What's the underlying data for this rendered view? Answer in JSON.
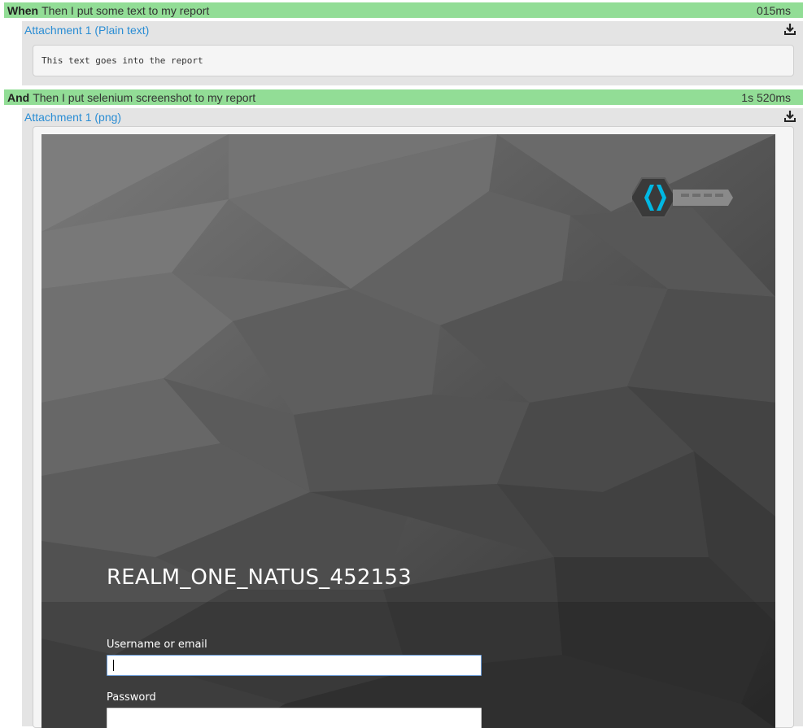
{
  "steps": [
    {
      "keyword": "When",
      "text": "Then I put some text to my report",
      "duration": "015ms"
    },
    {
      "keyword": "And",
      "text": "Then I put selenium screenshot to my report",
      "duration": "1s 520ms"
    }
  ],
  "attachments": [
    {
      "label": "Attachment 1 (Plain text)",
      "content": "This text goes into the report"
    },
    {
      "label": "Attachment 1 (png)"
    }
  ],
  "screenshot": {
    "realm_title": "REALM_ONE_NATUS_452153",
    "username_label": "Username or email",
    "username_value": "",
    "password_label": "Password",
    "password_value": ""
  },
  "colors": {
    "step_pass": "#92dd96",
    "link": "#2a8dd4",
    "logo_accent": "#00b8e3"
  },
  "icons": {
    "download": "download-icon",
    "logo": "keycloak-logo"
  }
}
